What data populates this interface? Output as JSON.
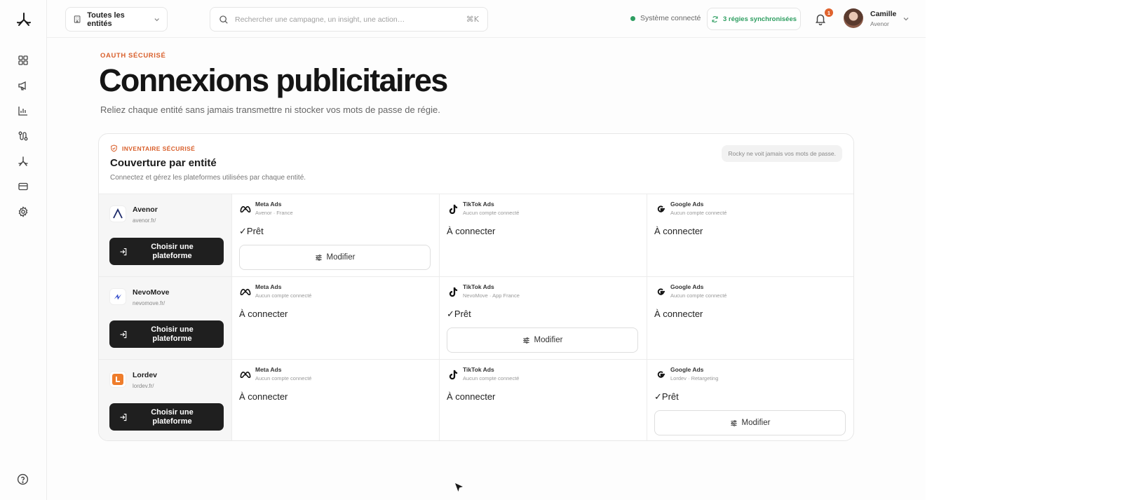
{
  "topbar": {
    "entity_selector": "Toutes les entités",
    "search_placeholder": "Rechercher une campagne, un insight, une action…",
    "search_shortcut": "⌘K",
    "system_status": "Système connecté",
    "sync_badge": "3 régies synchronisées",
    "notification_count": "1",
    "user_name": "Camille",
    "user_org": "Avenor"
  },
  "sidebar": {
    "icons": [
      "logo-icon",
      "dashboard-icon",
      "megaphone-icon",
      "bar-chart-icon",
      "route-icon",
      "brand-icon",
      "card-icon",
      "settings-icon",
      "help-icon"
    ]
  },
  "page": {
    "eyebrow": "OAUTH SÉCURISÉ",
    "title": "Connexions publicitaires",
    "subtitle": "Reliez chaque entité sans jamais transmettre ni stocker vos mots de passe de régie."
  },
  "card": {
    "eyebrow": "INVENTAIRE SÉCURISÉ",
    "title": "Couverture par entité",
    "subtitle": "Connectez et gérez les plateformes utilisées par chaque entité.",
    "note": "Rocky ne voit jamais vos mots de passe.",
    "choose_label_1": "Choisir une",
    "choose_label_2": "plateforme",
    "modify_label": "Modifier",
    "colors": {
      "accent": "#d9602c",
      "success": "#2e9e61",
      "dark_button": "#1f1f1f"
    }
  },
  "rows": [
    {
      "entity": {
        "name": "Avenor",
        "url": "avenor.fr/"
      },
      "platforms": [
        {
          "name": "Meta Ads",
          "account": "Avenor · France",
          "status": "✓Prêt",
          "connected": true
        },
        {
          "name": "TikTok Ads",
          "account": "Aucun compte connecté",
          "status": "À connecter",
          "connected": false
        },
        {
          "name": "Google Ads",
          "account": "Aucun compte connecté",
          "status": "À connecter",
          "connected": false
        }
      ]
    },
    {
      "entity": {
        "name": "NevoMove",
        "url": "nevomove.fr/"
      },
      "platforms": [
        {
          "name": "Meta Ads",
          "account": "Aucun compte connecté",
          "status": "À connecter",
          "connected": false
        },
        {
          "name": "TikTok Ads",
          "account": "NevoMove · App France",
          "status": "✓Prêt",
          "connected": true
        },
        {
          "name": "Google Ads",
          "account": "Aucun compte connecté",
          "status": "À connecter",
          "connected": false
        }
      ]
    },
    {
      "entity": {
        "name": "Lordev",
        "url": "lordev.fr/"
      },
      "platforms": [
        {
          "name": "Meta Ads",
          "account": "Aucun compte connecté",
          "status": "À connecter",
          "connected": false
        },
        {
          "name": "TikTok Ads",
          "account": "Aucun compte connecté",
          "status": "À connecter",
          "connected": false
        },
        {
          "name": "Google Ads",
          "account": "Lordev · Retargeting",
          "status": "✓Prêt",
          "connected": true
        }
      ]
    }
  ]
}
